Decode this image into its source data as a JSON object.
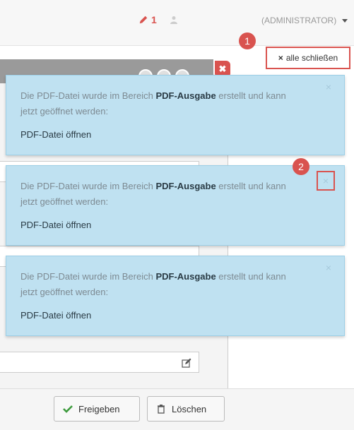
{
  "topbar": {
    "pencil_count": "1",
    "role": "(ADMINISTRATOR)"
  },
  "notification_controls": {
    "close_all_label": "alle schließen",
    "marker_1": "1",
    "marker_2": "2",
    "close_glyph": "×"
  },
  "notifications": [
    {
      "text_before": "Die PDF-Datei wurde im Bereich ",
      "text_bold": "PDF-Ausgabe",
      "text_after": " erstellt und kann jetzt geöffnet werden:",
      "link": "PDF-Datei öffnen"
    },
    {
      "text_before": "Die PDF-Datei wurde im Bereich ",
      "text_bold": "PDF-Ausgabe",
      "text_after": " erstellt und kann jetzt geöffnet werden:",
      "link": "PDF-Datei öffnen"
    },
    {
      "text_before": "Die PDF-Datei wurde im Bereich ",
      "text_bold": "PDF-Ausgabe",
      "text_after": " erstellt und kann jetzt geöffnet werden:",
      "link": "PDF-Datei öffnen"
    }
  ],
  "panel": {
    "close_glyph": "✖"
  },
  "footer": {
    "release_label": "Freigeben",
    "delete_label": "Löschen"
  },
  "icons": {
    "pencil": "pencil-icon",
    "user": "user-icon",
    "caret": "caret-down-icon",
    "close": "close-icon",
    "edit": "edit-icon",
    "check": "check-icon",
    "trash": "trash-icon"
  },
  "colors": {
    "notification_bg": "#bfe1f1",
    "highlight_red": "#d9534f",
    "check_green": "#3c9a3c"
  }
}
